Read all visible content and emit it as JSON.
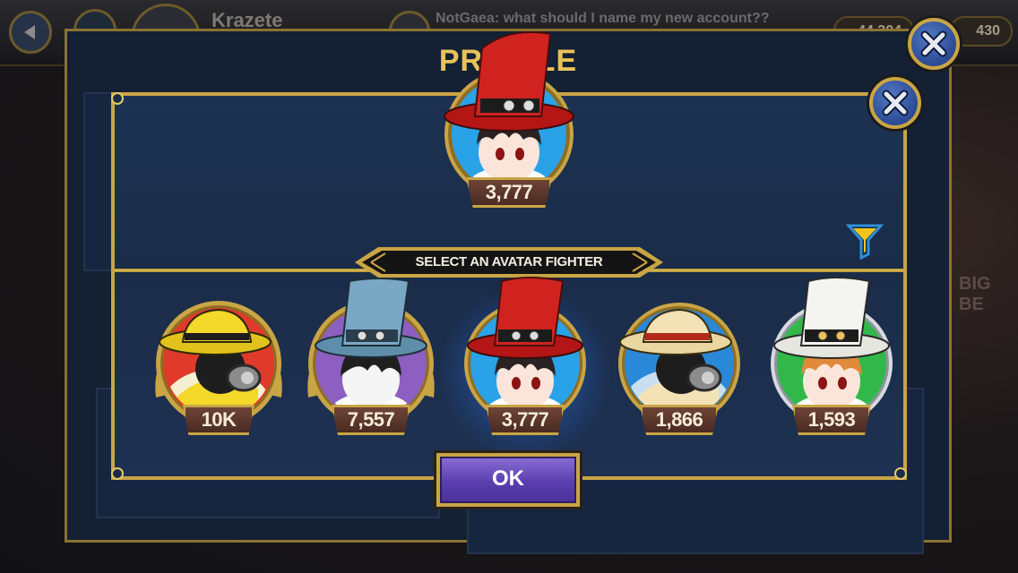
{
  "background": {
    "player_name": "Krazete",
    "chat_message": "NotGaea: what should I name my new account??",
    "currency_1": "44,304",
    "currency_2": "430",
    "panel_title": "PROFILE",
    "side_text": "BIG BE"
  },
  "modal": {
    "selected_avatar": {
      "count": "3,777",
      "hat_color": "#d0231f",
      "ring": "gold"
    },
    "banner_label": "SELECT AN AVATAR FIGHTER",
    "ok_label": "OK",
    "avatars": [
      {
        "count": "10K",
        "name_icon": "gas-mask-fighter-yellow-icon",
        "ring": "gold-winged",
        "bg": "#e03a2a",
        "hat": "#f4d82a"
      },
      {
        "count": "7,557",
        "name_icon": "top-hat-fighter-blue-icon",
        "ring": "gold-winged",
        "bg": "#8d5fc0",
        "hat": "#7aa7c4"
      },
      {
        "count": "3,777",
        "name_icon": "top-hat-fighter-red-icon",
        "ring": "gold",
        "bg": "#2aa2e8",
        "hat": "#d0231f"
      },
      {
        "count": "1,866",
        "name_icon": "gas-mask-fighter-white-icon",
        "ring": "gold",
        "bg": "#2a88d8",
        "hat": "#f2e2b6"
      },
      {
        "count": "1,593",
        "name_icon": "top-hat-fighter-white-icon",
        "ring": "silver",
        "bg": "#32b84a",
        "hat": "#f4f4f0"
      }
    ]
  },
  "colors": {
    "gold": "#c9a545",
    "panel": "#1a2c48",
    "ok_purple": "#5a3fae"
  }
}
